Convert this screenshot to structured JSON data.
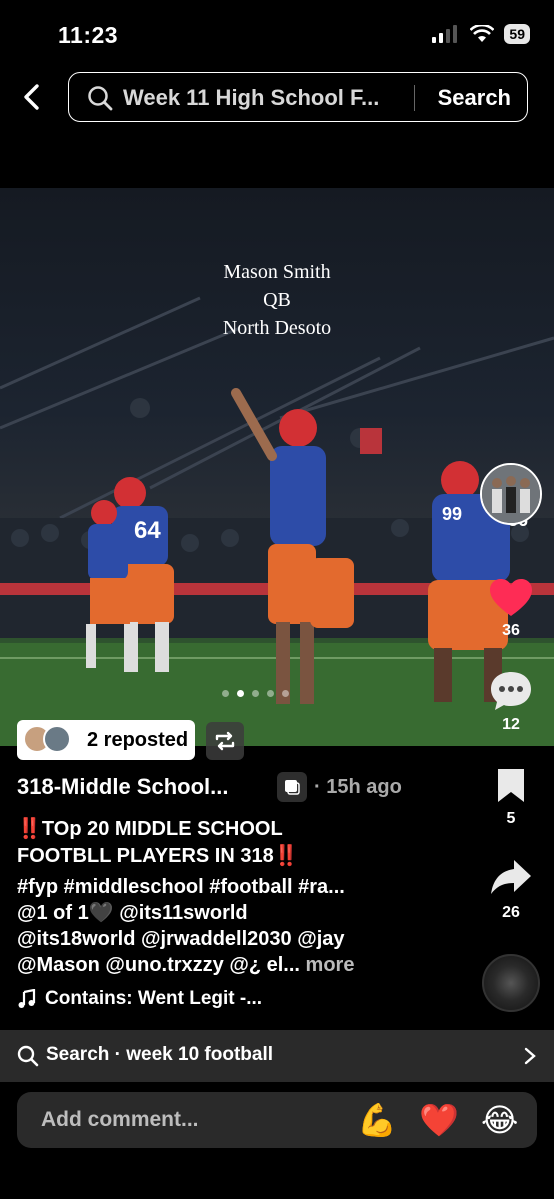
{
  "status_bar": {
    "time": "11:23",
    "battery": "59"
  },
  "search": {
    "query": "Week 11 High School F...",
    "button": "Search"
  },
  "photo": {
    "overlay_lines": [
      "Mason Smith",
      "QB",
      "North Desoto"
    ],
    "jersey_numbers": [
      "64",
      "99",
      "56"
    ]
  },
  "repost": {
    "label": "2 reposted"
  },
  "rail": {
    "likes": "36",
    "comments": "12",
    "saves": "5",
    "shares": "26"
  },
  "post": {
    "author": "318-Middle School...",
    "time_ago": "· 15h ago",
    "title_line1": "‼️TOp 20 MIDDLE SCHOOL",
    "title_line2": "FOOTBLL PLAYERS IN 318‼️",
    "body_line1": "#fyp #middleschool #football #ra...",
    "body_line2": "@1 of 1🖤 @its11sworld",
    "body_line3": "@its18world @jrwaddell2030 @jay",
    "body_line4": "@Mason @uno.trxzzy @¿ el...",
    "more": "more",
    "music": "Contains: Went Legit -..."
  },
  "related_search": {
    "label": "Search · week 10 football"
  },
  "comment": {
    "placeholder": "Add comment...",
    "emojis": [
      "💪",
      "❤️",
      "😂"
    ]
  },
  "colors": {
    "like_red": "#fe2c55",
    "background": "#000000",
    "bar": "#2a2a2a"
  }
}
